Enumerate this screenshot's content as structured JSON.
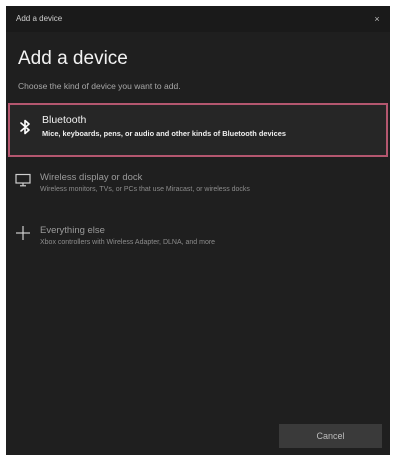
{
  "window": {
    "title": "Add a device",
    "close_glyph": "×"
  },
  "page": {
    "heading": "Add a device",
    "subheading": "Choose the kind of device you want to add."
  },
  "options": [
    {
      "name": "Bluetooth",
      "description": "Mice, keyboards, pens, or audio and other kinds of Bluetooth devices",
      "icon": "bluetooth-icon",
      "selected": true
    },
    {
      "name": "Wireless display or dock",
      "description": "Wireless monitors, TVs, or PCs that use Miracast, or wireless docks",
      "icon": "monitor-icon",
      "selected": false
    },
    {
      "name": "Everything else",
      "description": "Xbox controllers with Wireless Adapter, DLNA, and more",
      "icon": "plus-icon",
      "selected": false
    }
  ],
  "footer": {
    "cancel_label": "Cancel"
  },
  "colors": {
    "background": "#1f1f1f",
    "selection_border": "#b4576f",
    "button": "#3a3a3a"
  }
}
